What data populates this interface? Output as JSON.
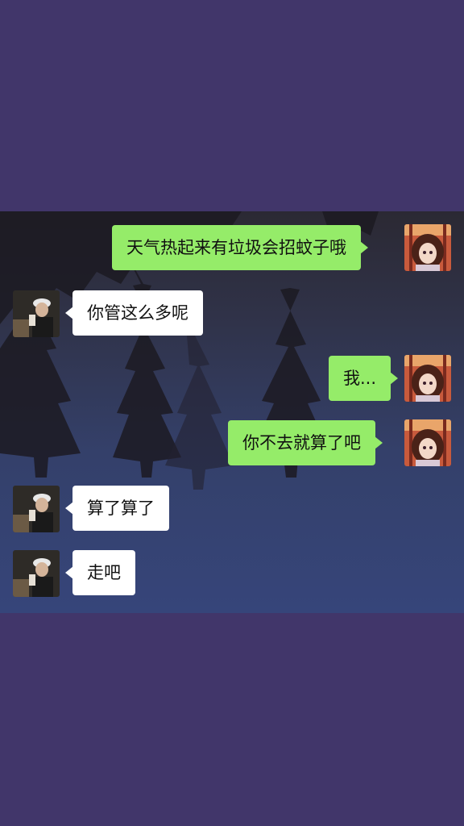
{
  "messages": [
    {
      "side": "right",
      "text": "天气热起来有垃圾会招蚊子哦",
      "avatar": "anime-girl-avatar"
    },
    {
      "side": "left",
      "text": "你管这么多呢",
      "avatar": "boy-photo-avatar"
    },
    {
      "side": "right",
      "text": "我...",
      "avatar": "anime-girl-avatar"
    },
    {
      "side": "right",
      "text": "你不去就算了吧",
      "avatar": "anime-girl-avatar"
    },
    {
      "side": "left",
      "text": "算了算了",
      "avatar": "boy-photo-avatar"
    },
    {
      "side": "left",
      "text": "走吧",
      "avatar": "boy-photo-avatar"
    }
  ],
  "colors": {
    "page_background": "#41366a",
    "sent_bubble": "#95ec69",
    "received_bubble": "#ffffff"
  }
}
